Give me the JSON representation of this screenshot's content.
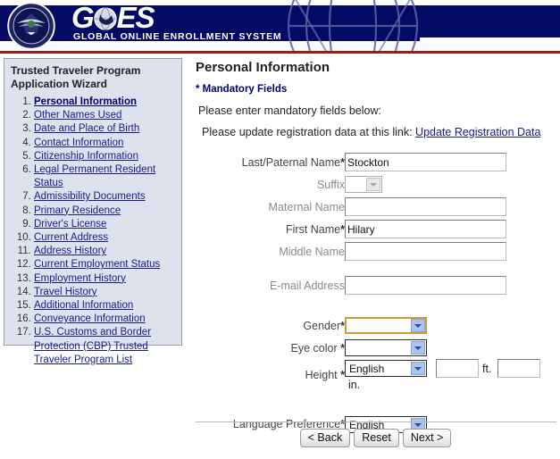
{
  "banner": {
    "logo_text": "GOES",
    "logo_subtitle": "GLOBAL ONLINE ENROLLMENT SYSTEM",
    "seal_name": "dhs-seal",
    "navy_color": "#040a63",
    "rule_color": "#9e1b1b"
  },
  "sidebar": {
    "title_line1": "Trusted Traveler Program",
    "title_line2": "Application Wizard",
    "items": [
      {
        "num": "1.",
        "label": "Personal Information",
        "current": true
      },
      {
        "num": "2.",
        "label": "Other Names Used",
        "current": false
      },
      {
        "num": "3.",
        "label": "Date and Place of Birth",
        "current": false
      },
      {
        "num": "4.",
        "label": "Contact Information",
        "current": false
      },
      {
        "num": "5.",
        "label": "Citizenship Information",
        "current": false
      },
      {
        "num": "6.",
        "label": "Legal Permanent Resident Status",
        "current": false
      },
      {
        "num": "7.",
        "label": "Admissibility Documents",
        "current": false
      },
      {
        "num": "8.",
        "label": "Primary Residence",
        "current": false
      },
      {
        "num": "9.",
        "label": "Driver's License",
        "current": false
      },
      {
        "num": "10.",
        "label": "Current Address",
        "current": false
      },
      {
        "num": "11.",
        "label": "Address History",
        "current": false
      },
      {
        "num": "12.",
        "label": "Current Employment Status",
        "current": false
      },
      {
        "num": "13.",
        "label": "Employment History",
        "current": false
      },
      {
        "num": "14.",
        "label": "Travel History",
        "current": false
      },
      {
        "num": "15.",
        "label": "Additional Information",
        "current": false
      },
      {
        "num": "16.",
        "label": "Conveyance Information",
        "current": false
      },
      {
        "num": "17.",
        "label": "U.S. Customs and Border Protection (CBP) Trusted Traveler Program List",
        "current": false
      }
    ]
  },
  "main": {
    "page_title": "Personal Information",
    "mandatory_note": "* Mandatory Fields",
    "enter_note": "Please enter mandatory fields below:",
    "registration_prefix": "Please update registration data at this link:",
    "registration_link": "Update Registration Data"
  },
  "form": {
    "last_name": {
      "label": "Last/Paternal Name",
      "required": true,
      "value": "Stockton",
      "placeholder": ""
    },
    "suffix": {
      "label": "Suffix",
      "required": false,
      "value": "",
      "disabled": true
    },
    "maternal_name": {
      "label": "Maternal Name",
      "required": false,
      "value": "",
      "placeholder": ""
    },
    "first_name": {
      "label": "First Name",
      "required": true,
      "value": "Hilary",
      "placeholder": ""
    },
    "middle_name": {
      "label": "Middle Name",
      "required": false,
      "value": "",
      "placeholder": ""
    },
    "email": {
      "label": "E-mail Address",
      "required": false,
      "value": "",
      "placeholder": ""
    },
    "gender": {
      "label": "Gender",
      "required": true,
      "value": "",
      "focused": true
    },
    "eye_color": {
      "label": "Eye color ",
      "required": true,
      "value": ""
    },
    "height": {
      "label": "Height ",
      "required": true,
      "unit_system": "English",
      "feet_value": "",
      "feet_unit": "ft.",
      "inches_value": "",
      "inches_unit": "in."
    },
    "language_preference": {
      "label": "Language Preference",
      "required": true,
      "value": "English"
    }
  },
  "footer": {
    "back_label": "< Back",
    "reset_label": "Reset",
    "next_label": "Next >"
  }
}
